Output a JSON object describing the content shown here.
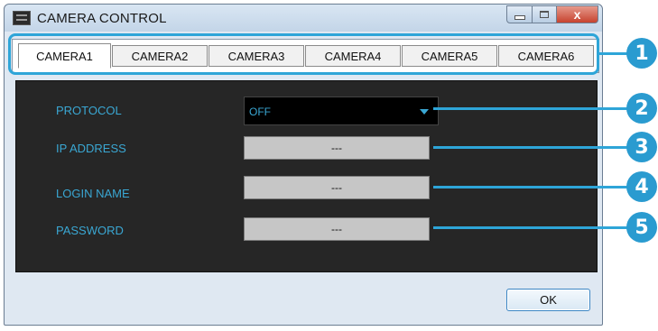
{
  "window": {
    "title": "CAMERA CONTROL",
    "controls": {
      "minimize": "",
      "maximize": "",
      "close": "x"
    }
  },
  "tabs": [
    {
      "label": "CAMERA1",
      "active": true
    },
    {
      "label": "CAMERA2",
      "active": false
    },
    {
      "label": "CAMERA3",
      "active": false
    },
    {
      "label": "CAMERA4",
      "active": false
    },
    {
      "label": "CAMERA5",
      "active": false
    },
    {
      "label": "CAMERA6",
      "active": false
    }
  ],
  "fields": {
    "protocol": {
      "label": "PROTOCOL",
      "value": "OFF"
    },
    "ip_address": {
      "label": "IP ADDRESS",
      "value": "---"
    },
    "login_name": {
      "label": "LOGIN NAME",
      "value": "---"
    },
    "password": {
      "label": "PASSWORD",
      "value": "---"
    }
  },
  "buttons": {
    "ok": "OK"
  },
  "callouts": [
    "1",
    "2",
    "3",
    "4",
    "5"
  ],
  "colors": {
    "accent": "#2a9bd0",
    "label_text": "#3aa7d3",
    "panel_bg": "#262626",
    "field_bg": "#c6c6c6"
  }
}
